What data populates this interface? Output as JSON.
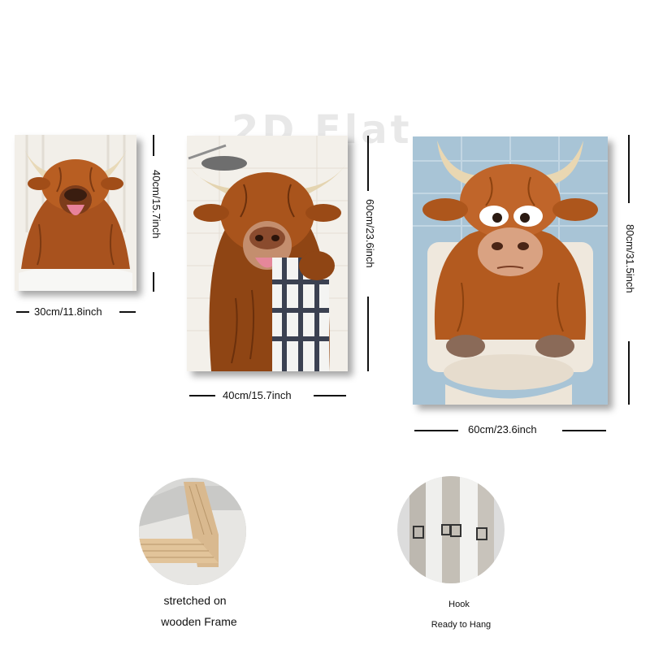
{
  "watermark": "2D Flat",
  "paintings": [
    {
      "width_label": "30cm/11.8inch",
      "height_label": "40cm/15.7inch"
    },
    {
      "width_label": "40cm/15.7inch",
      "height_label": "60cm/23.6inch"
    },
    {
      "width_label": "60cm/23.6inch",
      "height_label": "80cm/31.5inch"
    }
  ],
  "details": {
    "frame_caption_line1": "stretched on",
    "frame_caption_line2": "wooden Frame",
    "hook_caption_line1": "Hook",
    "hook_caption_line2": "Ready to Hang"
  }
}
